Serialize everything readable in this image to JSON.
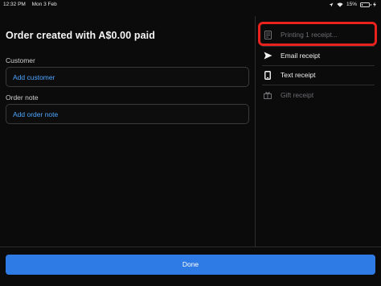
{
  "status_bar": {
    "time": "12:32 PM",
    "date": "Mon 3 Feb",
    "battery": "15%",
    "battery_level": 0.15
  },
  "order": {
    "title": "Order created with A$0.00 paid",
    "customer_label": "Customer",
    "customer_action": "Add customer",
    "note_label": "Order note",
    "note_action": "Add order note"
  },
  "receipt_options": [
    {
      "label": "Printing 1 receipt...",
      "icon": "printer-icon",
      "enabled": false
    },
    {
      "label": "Email receipt",
      "icon": "send-icon",
      "enabled": true
    },
    {
      "label": "Text receipt",
      "icon": "phone-icon",
      "enabled": true
    },
    {
      "label": "Gift receipt",
      "icon": "gift-icon",
      "enabled": false
    }
  ],
  "footer": {
    "done_label": "Done"
  },
  "colors": {
    "accent": "#2f7be6",
    "link": "#4ea6ff",
    "highlight": "#e8231d",
    "background": "#0b0b0c"
  }
}
